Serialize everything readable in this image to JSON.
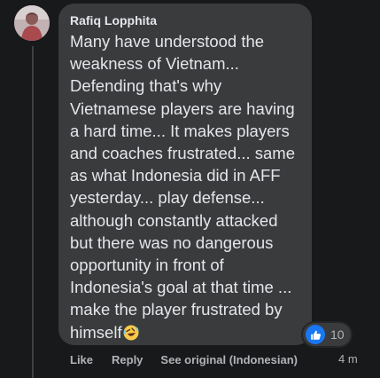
{
  "comment": {
    "author": "Rafiq Lopphita",
    "text": "Many have understood the\nweakness of Vietnam...\nDefending that's why\nVietnamese players are having\na hard time... It makes players\nand coaches frustrated... same\nas what Indonesia did in AFF\nyesterday... play defense...\nalthough constantly attacked\nbut there was no dangerous\nopportunity in front of\nIndonesia's goal at that time ...\nmake the player frustrated by\nhimself",
    "emoji": "rolling-on-floor-laughing",
    "reaction_icon": "like-icon",
    "reaction_count": "10",
    "timestamp": "4 m"
  },
  "actions": {
    "like_label": "Like",
    "reply_label": "Reply",
    "see_original_label": "See original (Indonesian)"
  },
  "colors": {
    "page_background": "#18191a",
    "bubble_background": "#3a3b3c",
    "text_primary": "#e4e6eb",
    "text_secondary": "#b0b3b8",
    "like_blue": "#1877f2"
  }
}
